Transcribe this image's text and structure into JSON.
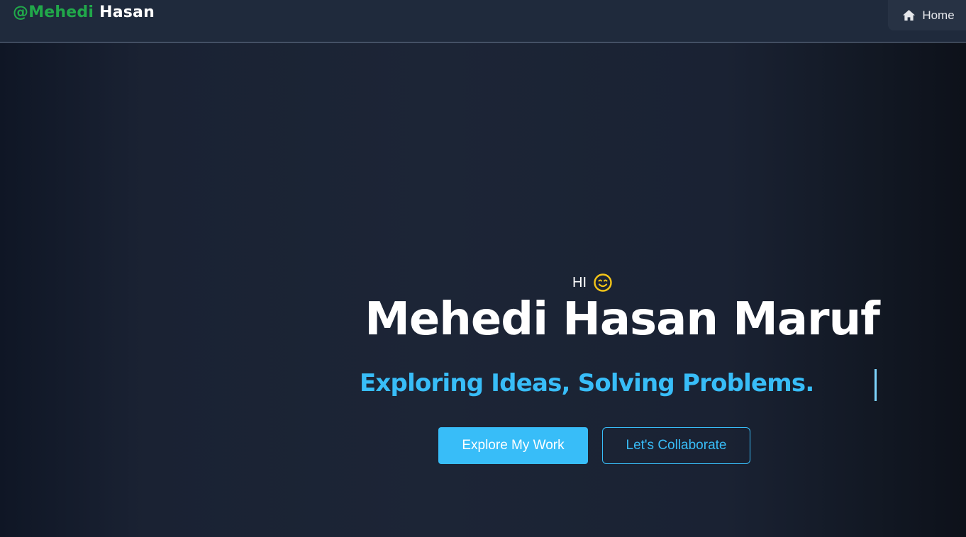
{
  "navbar": {
    "brand_prefix": "@Mehedi",
    "brand_suffix": "Hasan",
    "home_icon": "home-icon",
    "home_label": "Home"
  },
  "hero": {
    "greeting": "HI",
    "greeting_icon": "smiling-face-icon",
    "name": "Mehedi Hasan Maruf",
    "tagline": "Exploring Ideas, Solving Problems.",
    "primary_button": "Explore My Work",
    "secondary_button": "Let's Collaborate"
  },
  "colors": {
    "brand_green": "#21a84a",
    "accent": "#38bdf8",
    "navbar_bg": "#1f2a3c",
    "page_bg": "#1c2536",
    "emoji_yellow": "#f5c518"
  }
}
